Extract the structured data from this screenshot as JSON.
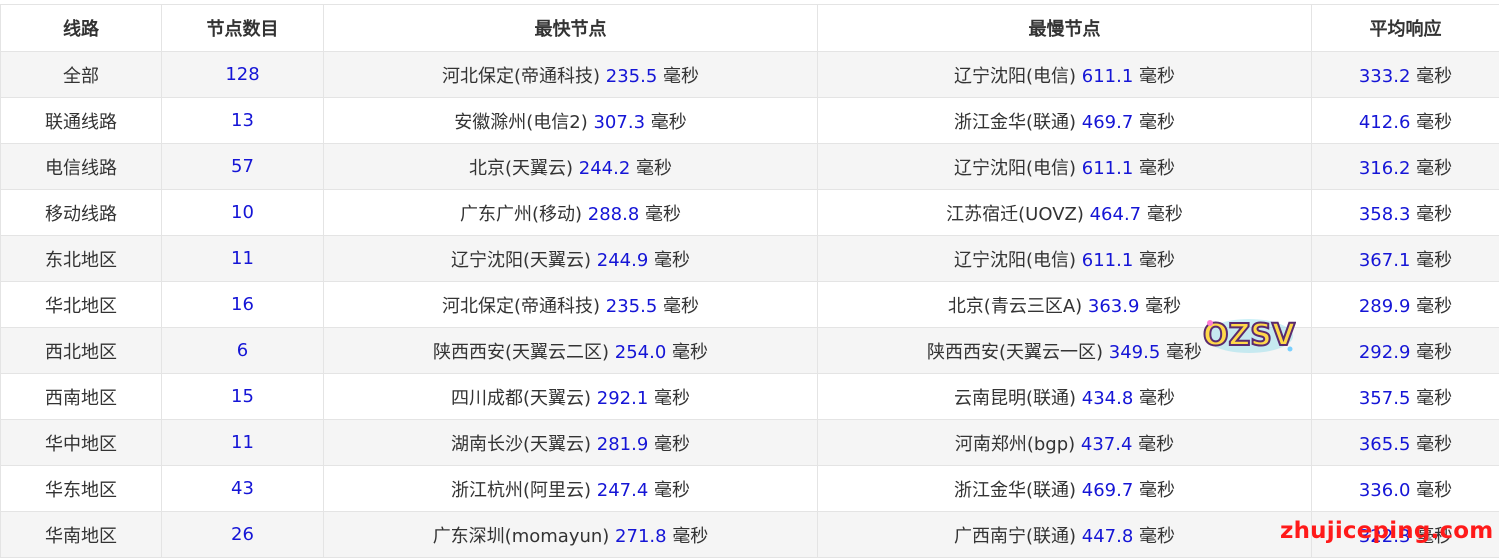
{
  "table": {
    "headers": [
      "线路",
      "节点数目",
      "最快节点",
      "最慢节点",
      "平均响应"
    ],
    "unit": "毫秒",
    "rows": [
      {
        "line": "全部",
        "count": "128",
        "fast_name": "河北保定(帝通科技)",
        "fast_ms": "235.5",
        "slow_name": "辽宁沈阳(电信)",
        "slow_ms": "611.1",
        "avg_ms": "333.2"
      },
      {
        "line": "联通线路",
        "count": "13",
        "fast_name": "安徽滁州(电信2)",
        "fast_ms": "307.3",
        "slow_name": "浙江金华(联通)",
        "slow_ms": "469.7",
        "avg_ms": "412.6"
      },
      {
        "line": "电信线路",
        "count": "57",
        "fast_name": "北京(天翼云)",
        "fast_ms": "244.2",
        "slow_name": "辽宁沈阳(电信)",
        "slow_ms": "611.1",
        "avg_ms": "316.2"
      },
      {
        "line": "移动线路",
        "count": "10",
        "fast_name": "广东广州(移动)",
        "fast_ms": "288.8",
        "slow_name": "江苏宿迁(UOVZ)",
        "slow_ms": "464.7",
        "avg_ms": "358.3"
      },
      {
        "line": "东北地区",
        "count": "11",
        "fast_name": "辽宁沈阳(天翼云)",
        "fast_ms": "244.9",
        "slow_name": "辽宁沈阳(电信)",
        "slow_ms": "611.1",
        "avg_ms": "367.1"
      },
      {
        "line": "华北地区",
        "count": "16",
        "fast_name": "河北保定(帝通科技)",
        "fast_ms": "235.5",
        "slow_name": "北京(青云三区A)",
        "slow_ms": "363.9",
        "avg_ms": "289.9"
      },
      {
        "line": "西北地区",
        "count": "6",
        "fast_name": "陕西西安(天翼云二区)",
        "fast_ms": "254.0",
        "slow_name": "陕西西安(天翼云一区)",
        "slow_ms": "349.5",
        "avg_ms": "292.9"
      },
      {
        "line": "西南地区",
        "count": "15",
        "fast_name": "四川成都(天翼云)",
        "fast_ms": "292.1",
        "slow_name": "云南昆明(联通)",
        "slow_ms": "434.8",
        "avg_ms": "357.5"
      },
      {
        "line": "华中地区",
        "count": "11",
        "fast_name": "湖南长沙(天翼云)",
        "fast_ms": "281.9",
        "slow_name": "河南郑州(bgp)",
        "slow_ms": "437.4",
        "avg_ms": "365.5"
      },
      {
        "line": "华东地区",
        "count": "43",
        "fast_name": "浙江杭州(阿里云)",
        "fast_ms": "247.4",
        "slow_name": "浙江金华(联通)",
        "slow_ms": "469.7",
        "avg_ms": "336.0"
      },
      {
        "line": "华南地区",
        "count": "26",
        "fast_name": "广东深圳(momayun)",
        "fast_ms": "271.8",
        "slow_name": "广西南宁(联通)",
        "slow_ms": "447.8",
        "avg_ms": "322.3"
      }
    ]
  },
  "badge": {
    "text": "OZSV",
    "icon": "ozsv-logo-icon"
  },
  "watermark": {
    "text": "zhujiceping.com"
  },
  "colors": {
    "value": "#1515d6",
    "text": "#333333",
    "stripe": "#f5f5f5",
    "border": "#e4e4e4",
    "watermark": "#ff1a1a"
  }
}
